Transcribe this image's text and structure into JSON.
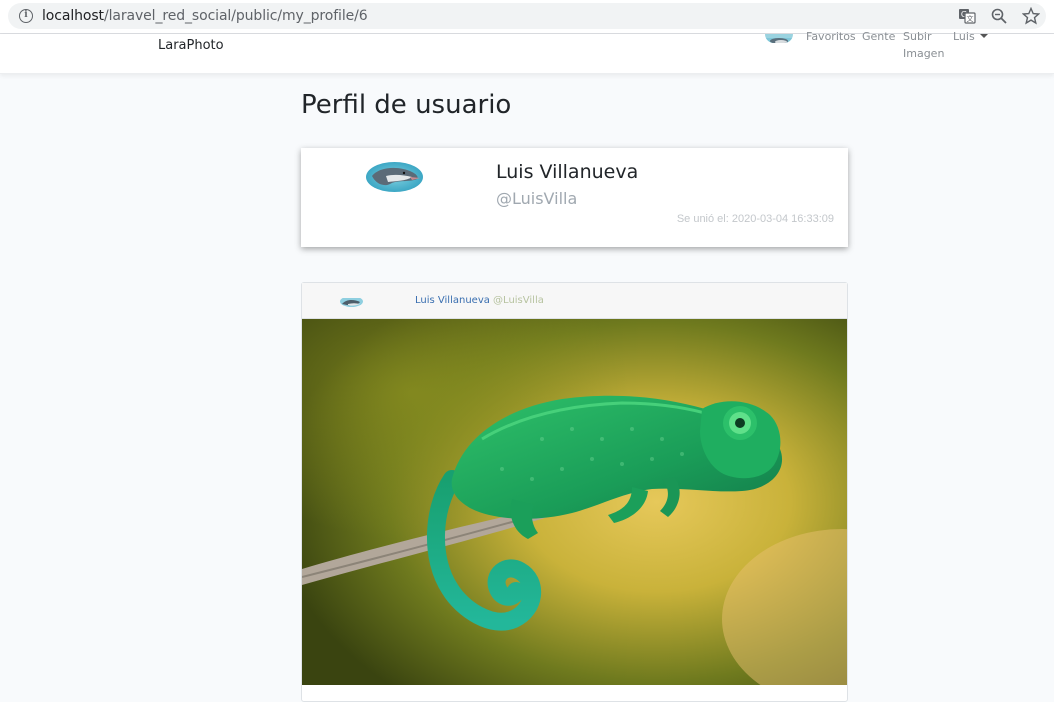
{
  "browser": {
    "url_host": "localhost",
    "url_path": "/laravel_red_social/public/my_profile/6",
    "icons": [
      "info-icon",
      "translate-icon",
      "zoom-icon",
      "star-icon"
    ]
  },
  "navbar": {
    "brand": "LaraPhoto",
    "links": {
      "favoritos": "Favoritos",
      "gente": "Gente",
      "subir_line1": "Subir",
      "subir_line2": "Imagen",
      "user": "Luis"
    }
  },
  "page": {
    "title": "Perfil de usuario"
  },
  "profile": {
    "name": "Luis Villanueva",
    "nick": "@LuisVilla",
    "joined": "Se unió el: 2020-03-04 16:33:09"
  },
  "post": {
    "author_name": "Luis Villanueva",
    "author_nick": "@LuisVilla"
  },
  "colors": {
    "background": "#f8fafc",
    "link_blue": "#3a6fb0",
    "muted": "#a0a8b0"
  }
}
